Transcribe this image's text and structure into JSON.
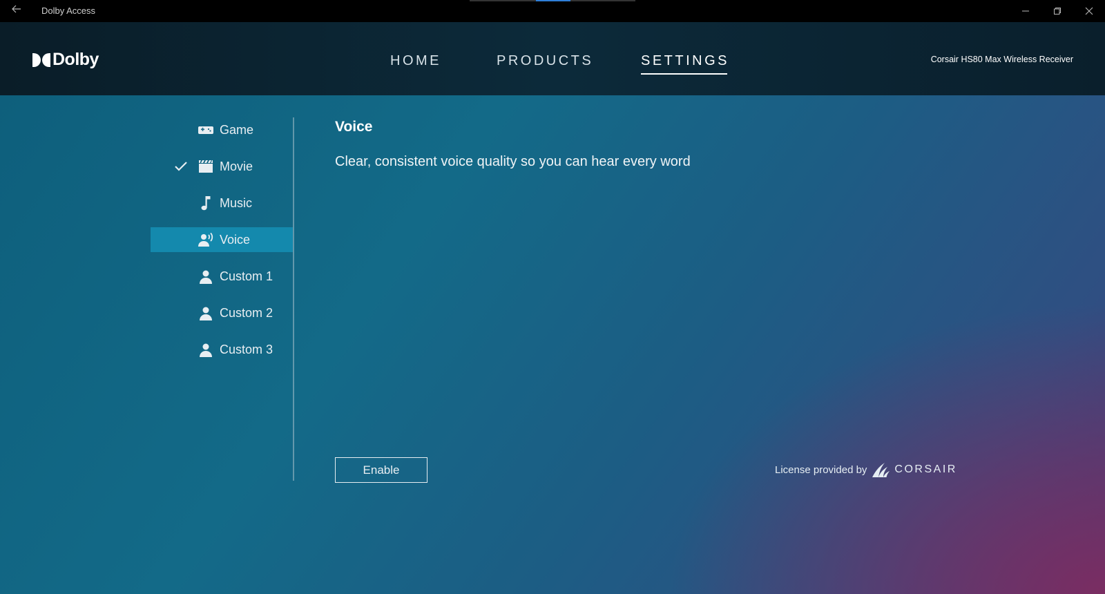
{
  "window": {
    "title": "Dolby Access",
    "back_icon": "back-arrow-icon",
    "controls": [
      "minimize-icon",
      "restore-icon",
      "close-icon"
    ]
  },
  "header": {
    "logo_text": "Dolby",
    "nav": {
      "home": "HOME",
      "products": "PRODUCTS",
      "settings": "SETTINGS",
      "active": "SETTINGS"
    },
    "device": "Corsair HS80 Max Wireless Receiver"
  },
  "sidebar": {
    "items": [
      {
        "label": "Game",
        "icon": "gamepad-icon",
        "checked": false,
        "active": false
      },
      {
        "label": "Movie",
        "icon": "clapperboard-icon",
        "checked": true,
        "active": false
      },
      {
        "label": "Music",
        "icon": "music-note-icon",
        "checked": false,
        "active": false
      },
      {
        "label": "Voice",
        "icon": "voice-icon",
        "checked": false,
        "active": true
      },
      {
        "label": "Custom 1",
        "icon": "person-icon",
        "checked": false,
        "active": false
      },
      {
        "label": "Custom 2",
        "icon": "person-icon",
        "checked": false,
        "active": false
      },
      {
        "label": "Custom 3",
        "icon": "person-icon",
        "checked": false,
        "active": false
      }
    ]
  },
  "content": {
    "title": "Voice",
    "description": "Clear, consistent voice quality so you can hear every word",
    "enable_label": "Enable"
  },
  "license": {
    "text": "License provided by",
    "brand": "CORSAIR"
  },
  "colors": {
    "active_item": "#1489ad",
    "header_bg": "#0b2533",
    "titlebar_bg": "#000000"
  }
}
